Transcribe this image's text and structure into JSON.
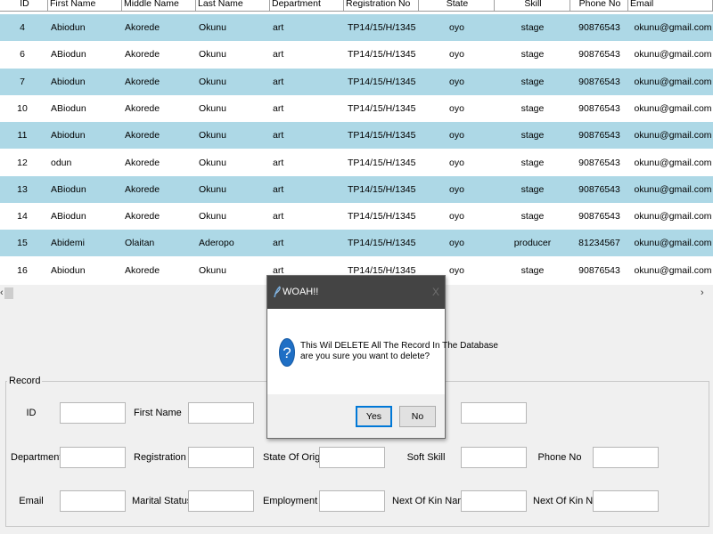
{
  "table": {
    "columns": [
      "ID",
      "First Name",
      "Middle Name",
      "Last Name",
      "Department",
      "Registration No",
      "State",
      "Skill",
      "Phone No",
      "Email"
    ],
    "rows": [
      [
        "4",
        "Abiodun",
        "Akorede",
        "Okunu",
        "art",
        "TP14/15/H/1345",
        "oyo",
        "stage",
        "90876543",
        "okunu@gmail.com"
      ],
      [
        "6",
        "ABiodun",
        "Akorede",
        "Okunu",
        "art",
        "TP14/15/H/1345",
        "oyo",
        "stage",
        "90876543",
        "okunu@gmail.com"
      ],
      [
        "7",
        "Abiodun",
        "Akorede",
        "Okunu",
        "art",
        "TP14/15/H/1345",
        "oyo",
        "stage",
        "90876543",
        "okunu@gmail.com"
      ],
      [
        "10",
        "ABiodun",
        "Akorede",
        "Okunu",
        "art",
        "TP14/15/H/1345",
        "oyo",
        "stage",
        "90876543",
        "okunu@gmail.com"
      ],
      [
        "11",
        "Abiodun",
        "Akorede",
        "Okunu",
        "art",
        "TP14/15/H/1345",
        "oyo",
        "stage",
        "90876543",
        "okunu@gmail.com"
      ],
      [
        "12",
        "odun",
        "Akorede",
        "Okunu",
        "art",
        "TP14/15/H/1345",
        "oyo",
        "stage",
        "90876543",
        "okunu@gmail.com"
      ],
      [
        "13",
        "ABiodun",
        "Akorede",
        "Okunu",
        "art",
        "TP14/15/H/1345",
        "oyo",
        "stage",
        "90876543",
        "okunu@gmail.com"
      ],
      [
        "14",
        "ABiodun",
        "Akorede",
        "Okunu",
        "art",
        "TP14/15/H/1345",
        "oyo",
        "stage",
        "90876543",
        "okunu@gmail.com"
      ],
      [
        "15",
        "Abidemi",
        "Olaitan",
        "Aderopo",
        "art",
        "TP14/15/H/1345",
        "oyo",
        "producer",
        "81234567",
        "okunu@gmail.com"
      ],
      [
        "16",
        "Abiodun",
        "Akorede",
        "Okunu",
        "art",
        "TP14/15/H/1345",
        "oyo",
        "stage",
        "90876543",
        "okunu@gmail.com"
      ]
    ]
  },
  "scrollbar": {
    "left_arrow": "‹",
    "right_arrow": "›"
  },
  "record": {
    "legend": "Record",
    "labels": {
      "id": "ID",
      "first_name": "First Name",
      "department": "Department",
      "registration": "Registration",
      "state_of_origin": "State Of Origin",
      "soft_skill": "Soft Skill",
      "phone_no": "Phone No",
      "email": "Email",
      "marital_status": "Marital Status",
      "employment": "Employment",
      "next_of_kin_name": "Next Of Kin Name",
      "next_of_kin_no": "Next Of Kin No"
    }
  },
  "dialog": {
    "title": "WOAH!!",
    "close": "X",
    "message_line1": "This Wil DELETE All The Record In The Database",
    "message_line2": "are you sure you want to delete?",
    "yes": "Yes",
    "no": "No"
  },
  "colors": {
    "row_alt": "#add8e6",
    "dialog_title_bg": "#444444",
    "accent": "#0078d7"
  }
}
